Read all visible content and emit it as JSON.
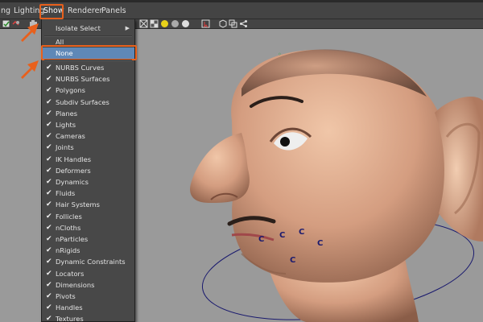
{
  "menubar": {
    "items": [
      "ng",
      "Lighting",
      "Show",
      "Renderer",
      "Panels"
    ]
  },
  "show_menu": {
    "isolate_select": "Isolate Select",
    "all": "All",
    "none": "None",
    "items": [
      "NURBS Curves",
      "NURBS Surfaces",
      "Polygons",
      "Subdiv Surfaces",
      "Planes",
      "Lights",
      "Cameras",
      "Joints",
      "IK Handles",
      "Deformers",
      "Dynamics",
      "Fluids",
      "Hair Systems",
      "Follicles",
      "nCloths",
      "nParticles",
      "nRigids",
      "Dynamic Constraints",
      "Locators",
      "Dimensions",
      "Pivots",
      "Handles",
      "Textures"
    ],
    "check_glyph": "✔",
    "submenu_glyph": "▶"
  },
  "viewport": {
    "cluster_marker": "C",
    "cluster_count": 6
  },
  "colors": {
    "highlight_outline": "#e8601c",
    "selected_row": "#5f88b7",
    "menu_bg": "#484848",
    "viewport_bg": "#9a9a9a",
    "skin": "#d9a889"
  },
  "icons": [
    "checkbox-icon",
    "link-icon",
    "camera-icon",
    "wireframe-shaded-icon",
    "light-sphere-icon",
    "grey-sphere-icon",
    "smooth-sphere-icon",
    "xray-icon",
    "select-camera-icon",
    "bookmark-icon",
    "isolate-icon",
    "share-icon"
  ]
}
